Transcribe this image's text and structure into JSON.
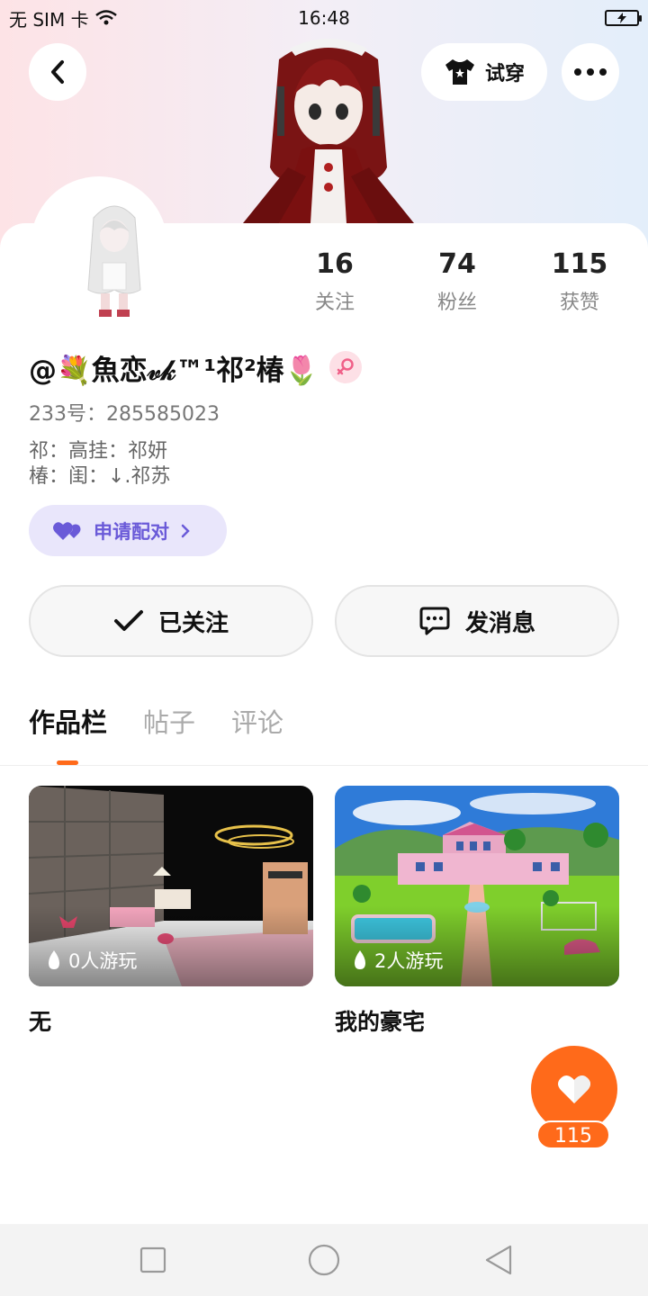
{
  "status_bar": {
    "carrier": "无 SIM 卡",
    "time": "16:48"
  },
  "header": {
    "tryon_label": "试穿"
  },
  "profile": {
    "stats": [
      {
        "value": "16",
        "label": "关注"
      },
      {
        "value": "74",
        "label": "粉丝"
      },
      {
        "value": "115",
        "label": "获赞"
      }
    ],
    "username": "@💐魚恋𝓋𝓀™¹祁²椿🌷",
    "id_line": "233号：285585023",
    "bio_lines": [
      "祁：高挂：祁妍",
      "椿：闺：↓.祁苏"
    ],
    "pair_label": "申请配对"
  },
  "actions": {
    "follow_label": "已关注",
    "message_label": "发消息"
  },
  "tabs": [
    "作品栏",
    "帖子",
    "评论"
  ],
  "works": [
    {
      "plays": "0人游玩",
      "title": "无"
    },
    {
      "plays": "2人游玩",
      "title": "我的豪宅"
    }
  ],
  "like_fab": {
    "count": "115"
  },
  "colors": {
    "accent": "#ff6a1a",
    "pair": "#6a5ad8",
    "gender": "#f06088"
  }
}
